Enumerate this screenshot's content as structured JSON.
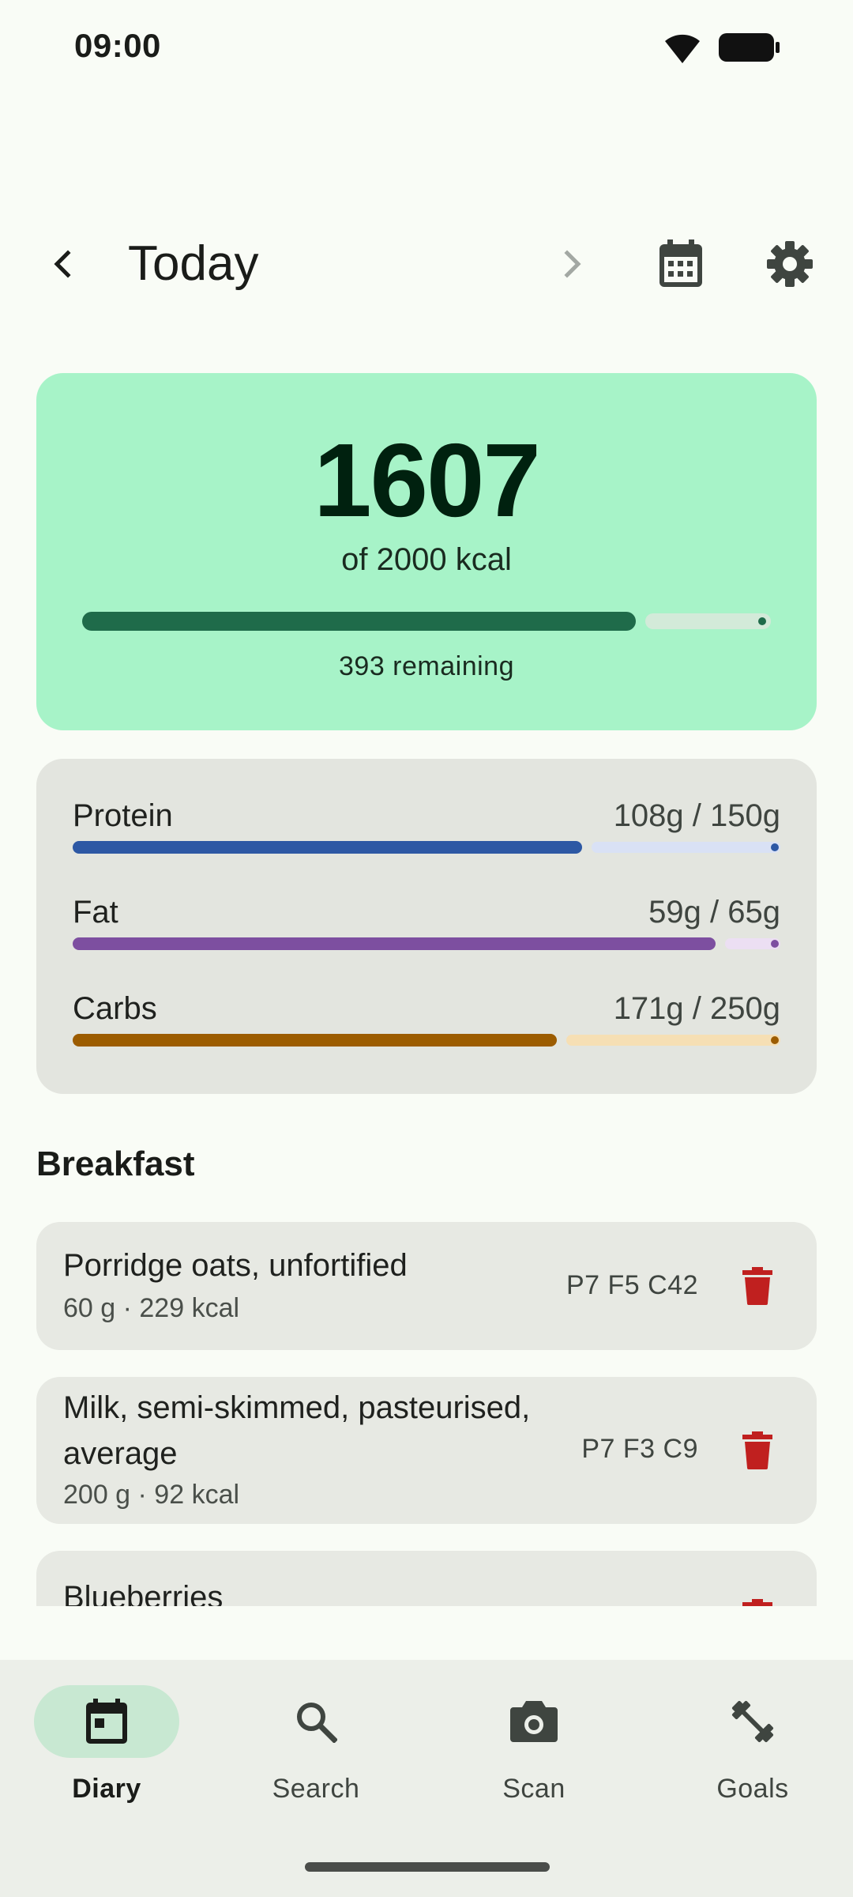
{
  "status_bar": {
    "time": "09:00"
  },
  "header": {
    "title": "Today",
    "back_icon": "chevron-left-icon",
    "forward_icon": "chevron-right-icon",
    "calendar_icon": "calendar-icon",
    "settings_icon": "gear-icon"
  },
  "calories": {
    "consumed": "1607",
    "goal_text": "of 2000 kcal",
    "remaining_text": "393 remaining",
    "progress_fraction": 0.8035,
    "fill_color": "#1f6b4a",
    "card_color": "#a7f3c8"
  },
  "macros": [
    {
      "name": "Protein",
      "value": "108g / 150g",
      "fraction": 0.72,
      "color": "#2d58a4",
      "track_color": "#d9e1f5"
    },
    {
      "name": "Fat",
      "value": "59g / 65g",
      "fraction": 0.908,
      "color": "#7d4fa0",
      "track_color": "#ecdff3"
    },
    {
      "name": "Carbs",
      "value": "171g / 250g",
      "fraction": 0.684,
      "color": "#9c5c00",
      "track_color": "#f6dfb4"
    }
  ],
  "meals": {
    "breakfast_title": "Breakfast",
    "items": [
      {
        "name": "Porridge oats, unfortified",
        "meta": "60 g · 229 kcal",
        "macros": "P7 F5 C42"
      },
      {
        "name": "Milk, semi-skimmed, pasteurised, average",
        "meta": "200 g · 92 kcal",
        "macros": "P7 F3 C9"
      },
      {
        "name": "Blueberries",
        "meta": "",
        "macros": ""
      }
    ],
    "delete_color": "#c0201f"
  },
  "nav": [
    {
      "label": "Diary",
      "icon": "calendar-icon",
      "active": true
    },
    {
      "label": "Search",
      "icon": "search-icon",
      "active": false
    },
    {
      "label": "Scan",
      "icon": "camera-icon",
      "active": false
    },
    {
      "label": "Goals",
      "icon": "dumbbell-icon",
      "active": false
    }
  ]
}
